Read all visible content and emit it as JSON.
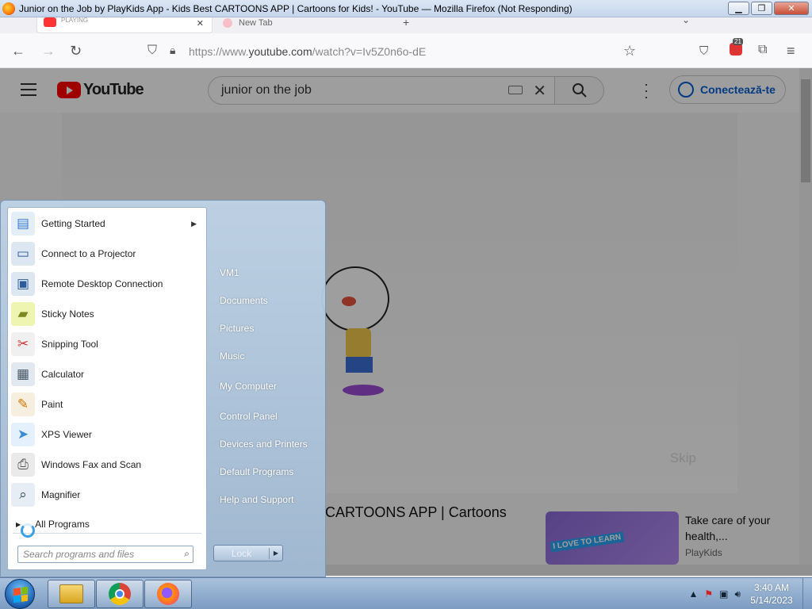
{
  "window": {
    "title": "Junior on the Job by PlayKids App - Kids Best CARTOONS APP | Cartoons for Kids! - YouTube — Mozilla Firefox (Not Responding)",
    "minimize": "▁",
    "maximize": "❐",
    "close": "✕"
  },
  "tabs": [
    {
      "label": "",
      "status": "PLAYING"
    },
    {
      "label": "New Tab"
    }
  ],
  "browser": {
    "url_prefix": "https://www.",
    "url_host": "youtube.com",
    "url_rest": "/watch?v=Iv5Z0n6o-dE",
    "notification_badge": "21"
  },
  "youtube": {
    "logo_text": "YouTube",
    "search_query": "junior on the job",
    "sign_in": "Conectează-te",
    "skip_label": "Skip",
    "video_title_fragment": "CARTOONS APP | Cartoons",
    "recommendation": {
      "title": "Take care of your health,...",
      "channel": "PlayKids",
      "badge": "I LOVE TO LEARN"
    }
  },
  "start_menu": {
    "programs": [
      {
        "label": "Getting Started",
        "icon": "getting-started-icon",
        "has_submenu": true
      },
      {
        "label": "Connect to a Projector",
        "icon": "projector-icon"
      },
      {
        "label": "Remote Desktop Connection",
        "icon": "remote-desktop-icon"
      },
      {
        "label": "Sticky Notes",
        "icon": "sticky-notes-icon"
      },
      {
        "label": "Snipping Tool",
        "icon": "scissors-icon"
      },
      {
        "label": "Calculator",
        "icon": "calculator-icon"
      },
      {
        "label": "Paint",
        "icon": "paint-icon"
      },
      {
        "label": "XPS Viewer",
        "icon": "xps-viewer-icon"
      },
      {
        "label": "Windows Fax and Scan",
        "icon": "fax-icon"
      },
      {
        "label": "Magnifier",
        "icon": "magnifier-icon"
      }
    ],
    "all_programs": "All Programs",
    "search_placeholder": "Search programs and files",
    "places": [
      "VM1",
      "Documents",
      "Pictures",
      "Music",
      "My Computer",
      "Control Panel",
      "Devices and Printers",
      "Default Programs",
      "Help and Support"
    ],
    "lock_label": "Lock"
  },
  "taskbar": {
    "apps": [
      "windows-explorer-icon",
      "chrome-icon",
      "firefox-icon"
    ],
    "time": "3:40 AM",
    "date": "5/14/2023"
  }
}
